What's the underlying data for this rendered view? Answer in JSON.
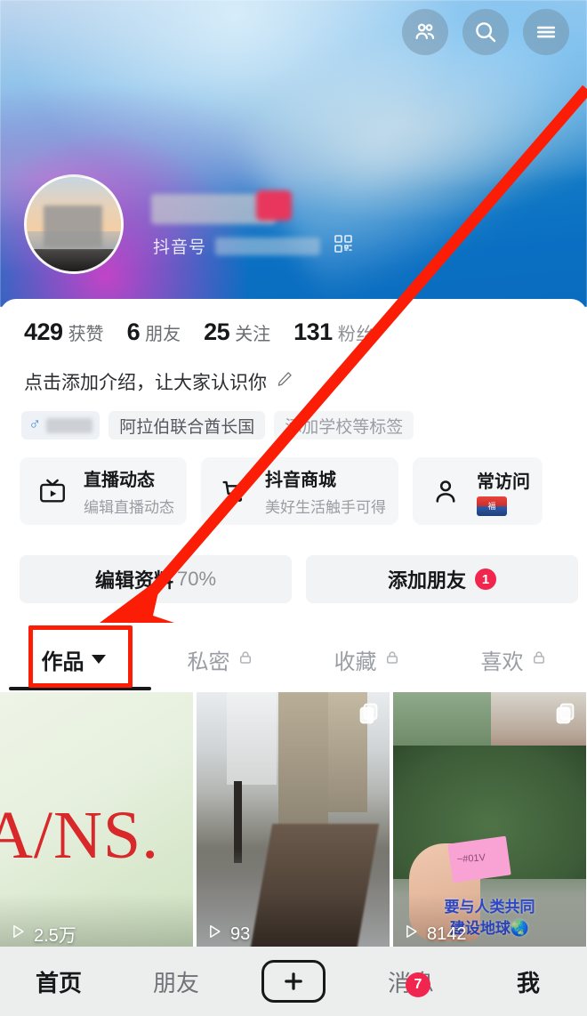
{
  "header": {
    "actions": [
      {
        "name": "friends-icon",
        "label": "好友"
      },
      {
        "name": "search-icon",
        "label": "搜索"
      },
      {
        "name": "menu-icon",
        "label": "菜单"
      }
    ]
  },
  "profile": {
    "douyin_label": "抖音号",
    "douyin_id": "",
    "nickname": "",
    "qr_label": "二维码",
    "intro_placeholder": "点击添加介绍，让大家认识你",
    "tags": [
      {
        "text": "",
        "gender": "♂",
        "blurred": true
      },
      {
        "text": "阿拉伯联合酋长国",
        "blurred": false
      },
      {
        "text": "添加学校等标签",
        "blurred": false,
        "ghost": true
      }
    ]
  },
  "stats": [
    {
      "num": "429",
      "label": "获赞"
    },
    {
      "num": "6",
      "label": "朋友"
    },
    {
      "num": "25",
      "label": "关注"
    },
    {
      "num": "131",
      "label": "粉丝"
    }
  ],
  "cards": [
    {
      "icon": "live-tv-icon",
      "title": "直播动态",
      "sub": "编辑直播动态"
    },
    {
      "icon": "shopping-cart-icon",
      "title": "抖音商城",
      "sub": "美好生活触手可得"
    },
    {
      "icon": "person-icon",
      "title": "常访问",
      "sub": ""
    }
  ],
  "wide_buttons": [
    {
      "name": "edit-profile-button",
      "label": "编辑资料",
      "suffix": "70%",
      "badge": ""
    },
    {
      "name": "add-friend-button",
      "label": "添加朋友",
      "suffix": "",
      "badge": "1"
    }
  ],
  "tabs": [
    {
      "label": "作品",
      "active": true,
      "locked": false,
      "caret": true
    },
    {
      "label": "私密",
      "active": false,
      "locked": true,
      "caret": false
    },
    {
      "label": "收藏",
      "active": false,
      "locked": true,
      "caret": false
    },
    {
      "label": "喜欢",
      "active": false,
      "locked": true,
      "caret": false
    }
  ],
  "videos": [
    {
      "plays": "2.5万",
      "overlay_text": "A/NS.",
      "multi": false,
      "caption1": "",
      "caption2": ""
    },
    {
      "plays": "93",
      "overlay_text": "",
      "multi": true,
      "caption1": "",
      "caption2": ""
    },
    {
      "plays": "8142",
      "overlay_text": "~#01V",
      "multi": true,
      "caption1": "要与人类共同",
      "caption2": "建设地球🌏"
    }
  ],
  "bottom_nav": [
    {
      "label": "首页",
      "active": true,
      "badge": ""
    },
    {
      "label": "朋友",
      "active": false,
      "badge": ""
    },
    {
      "label": "+",
      "active": false,
      "badge": "",
      "is_plus": true
    },
    {
      "label": "消息",
      "active": false,
      "badge": "7"
    },
    {
      "label": "我",
      "active": true,
      "badge": ""
    }
  ],
  "annotation": {
    "arrow_color": "#fb1d05",
    "box_color": "#fb1d05",
    "points_to": "作品"
  }
}
